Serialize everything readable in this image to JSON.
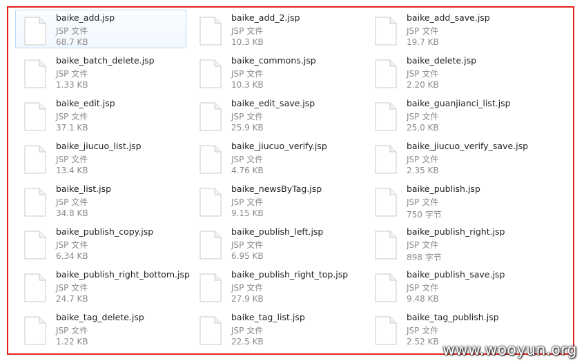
{
  "files": [
    {
      "name": "baike_add.jsp",
      "type": "JSP 文件",
      "size": "68.7 KB",
      "selected": true
    },
    {
      "name": "baike_add_2.jsp",
      "type": "JSP 文件",
      "size": "10.3 KB"
    },
    {
      "name": "baike_add_save.jsp",
      "type": "JSP 文件",
      "size": "19.7 KB"
    },
    {
      "name": "baike_batch_delete.jsp",
      "type": "JSP 文件",
      "size": "1.33 KB"
    },
    {
      "name": "baike_commons.jsp",
      "type": "JSP 文件",
      "size": "10.3 KB"
    },
    {
      "name": "baike_delete.jsp",
      "type": "JSP 文件",
      "size": "2.20 KB"
    },
    {
      "name": "baike_edit.jsp",
      "type": "JSP 文件",
      "size": "37.1 KB"
    },
    {
      "name": "baike_edit_save.jsp",
      "type": "JSP 文件",
      "size": "25.9 KB"
    },
    {
      "name": "baike_guanjianci_list.jsp",
      "type": "JSP 文件",
      "size": "25.0 KB"
    },
    {
      "name": "baike_jiucuo_list.jsp",
      "type": "JSP 文件",
      "size": "13.4 KB"
    },
    {
      "name": "baike_jiucuo_verify.jsp",
      "type": "JSP 文件",
      "size": "4.76 KB"
    },
    {
      "name": "baike_jiucuo_verify_save.jsp",
      "type": "JSP 文件",
      "size": "2.35 KB"
    },
    {
      "name": "baike_list.jsp",
      "type": "JSP 文件",
      "size": "34.8 KB"
    },
    {
      "name": "baike_newsByTag.jsp",
      "type": "JSP 文件",
      "size": "9.15 KB"
    },
    {
      "name": "baike_publish.jsp",
      "type": "JSP 文件",
      "size": "750 字节"
    },
    {
      "name": "baike_publish_copy.jsp",
      "type": "JSP 文件",
      "size": "6.34 KB"
    },
    {
      "name": "baike_publish_left.jsp",
      "type": "JSP 文件",
      "size": "6.95 KB"
    },
    {
      "name": "baike_publish_right.jsp",
      "type": "JSP 文件",
      "size": "898 字节"
    },
    {
      "name": "baike_publish_right_bottom.jsp",
      "type": "JSP 文件",
      "size": "24.7 KB"
    },
    {
      "name": "baike_publish_right_top.jsp",
      "type": "JSP 文件",
      "size": "27.9 KB"
    },
    {
      "name": "baike_publish_save.jsp",
      "type": "JSP 文件",
      "size": "9.48 KB"
    },
    {
      "name": "baike_tag_delete.jsp",
      "type": "JSP 文件",
      "size": "1.22 KB"
    },
    {
      "name": "baike_tag_list.jsp",
      "type": "JSP 文件",
      "size": "22.5 KB"
    },
    {
      "name": "baike_tag_publish.jsp",
      "type": "JSP 文件",
      "size": "2.52 KB"
    }
  ],
  "icon": "generic-file-icon",
  "watermark": "www.wooyun.org",
  "colors": {
    "frame": "#e3201b",
    "selection": "#f1f7fe",
    "selection_border": "#bcd8f5",
    "secondary_text": "#8a8a8a"
  }
}
